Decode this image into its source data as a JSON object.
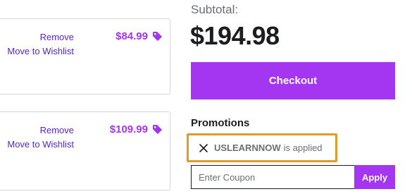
{
  "cart": {
    "items": [
      {
        "remove_label": "Remove",
        "wishlist_label": "Move to Wishlist",
        "price": "$84.99"
      },
      {
        "remove_label": "Remove",
        "wishlist_label": "Move to Wishlist",
        "price": "$109.99"
      }
    ]
  },
  "summary": {
    "subtotal_label": "Subtotal:",
    "subtotal_amount": "$194.98",
    "checkout_label": "Checkout"
  },
  "promotions": {
    "heading": "Promotions",
    "applied_code": "USLEARNNOW",
    "applied_status": "is applied",
    "coupon_placeholder": "Enter Coupon",
    "apply_label": "Apply"
  },
  "icons": {
    "price_tag": "tag-icon",
    "remove_coupon": "close-icon"
  },
  "colors": {
    "accent": "#a435f0",
    "link": "#5624d0",
    "highlight_border": "#e29a29"
  }
}
